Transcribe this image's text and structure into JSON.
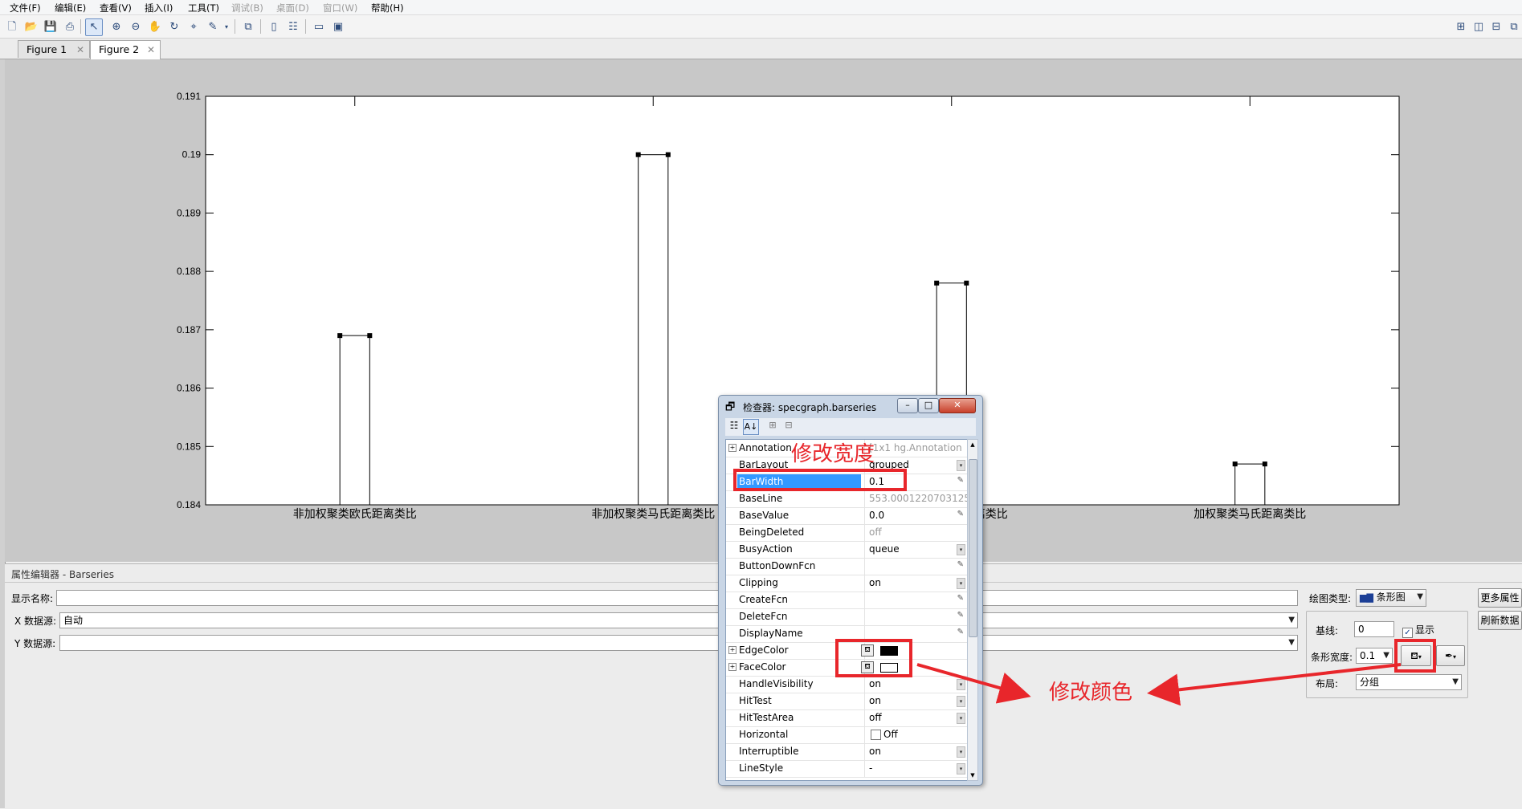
{
  "menubar": [
    "文件(F)",
    "编辑(E)",
    "查看(V)",
    "插入(I)",
    "工具(T)",
    "调试(B)",
    "桌面(D)",
    "窗口(W)",
    "帮助(H)"
  ],
  "tabs": [
    {
      "label": "Figure 1",
      "selected": false
    },
    {
      "label": "Figure 2",
      "selected": true
    }
  ],
  "chart_data": {
    "type": "bar",
    "categories": [
      "非加权聚类欧氏距离类比",
      "非加权聚类马氏距离类比",
      "加权聚类欧氏距离类比",
      "加权聚类马氏距离类比"
    ],
    "values": [
      0.1869,
      0.19,
      0.1878,
      0.1847
    ],
    "ylim": [
      0.184,
      0.191
    ],
    "yticks": [
      "0.184",
      "0.185",
      "0.186",
      "0.187",
      "0.188",
      "0.189",
      "0.19",
      "0.191"
    ],
    "bar_width": 0.1,
    "face_color": "#ffffff",
    "edge_color": "#000000"
  },
  "property_editor": {
    "header": "属性编辑器 - Barseries",
    "display_name_label": "显示名称:",
    "display_name_value": "",
    "x_source_label": "X 数据源:",
    "x_source_value": "自动",
    "y_source_label": "Y 数据源:",
    "y_source_value": "",
    "plot_type_label": "绘图类型:",
    "plot_type_value": "条形图",
    "baseline_label": "基线:",
    "baseline_value": "0",
    "show_label": "显示",
    "bar_width_label": "条形宽度:",
    "bar_width_value": "0.1",
    "layout_label": "布局:",
    "layout_value": "分组",
    "more_props_label": "更多属性",
    "refresh_label": "刷新数据"
  },
  "inspector": {
    "title": "检查器:  specgraph.barseries",
    "rows": [
      {
        "name": "Annotation",
        "value": "[1x1 hg.Annotation",
        "dim": true,
        "expand": true
      },
      {
        "name": "BarLayout",
        "value": "grouped",
        "dd": true
      },
      {
        "name": "BarWidth",
        "value": "0.1",
        "selected": true,
        "edit": true
      },
      {
        "name": "BaseLine",
        "value": "553.0001220703125",
        "dim": true
      },
      {
        "name": "BaseValue",
        "value": "0.0",
        "edit": true
      },
      {
        "name": "BeingDeleted",
        "value": "off",
        "dim": true
      },
      {
        "name": "BusyAction",
        "value": "queue",
        "dd": true
      },
      {
        "name": "ButtonDownFcn",
        "value": "",
        "edit": true
      },
      {
        "name": "Clipping",
        "value": "on",
        "dd": true
      },
      {
        "name": "CreateFcn",
        "value": "",
        "edit": true
      },
      {
        "name": "DeleteFcn",
        "value": "",
        "edit": true
      },
      {
        "name": "DisplayName",
        "value": "",
        "edit": true
      },
      {
        "name": "EdgeColor",
        "value": "",
        "expand": true,
        "swatch": "#000000"
      },
      {
        "name": "FaceColor",
        "value": "",
        "expand": true,
        "swatch": "#ffffff"
      },
      {
        "name": "HandleVisibility",
        "value": "on",
        "dd": true
      },
      {
        "name": "HitTest",
        "value": "on",
        "dd": true
      },
      {
        "name": "HitTestArea",
        "value": "off",
        "dd": true
      },
      {
        "name": "Horizontal",
        "value": "Off",
        "checkbox": true
      },
      {
        "name": "Interruptible",
        "value": "on",
        "dd": true
      },
      {
        "name": "LineStyle",
        "value": "-",
        "dd": true
      }
    ]
  },
  "annotations": {
    "modify_width": "修改宽度",
    "modify_color": "修改颜色",
    "accent_color": "#e8262b"
  }
}
